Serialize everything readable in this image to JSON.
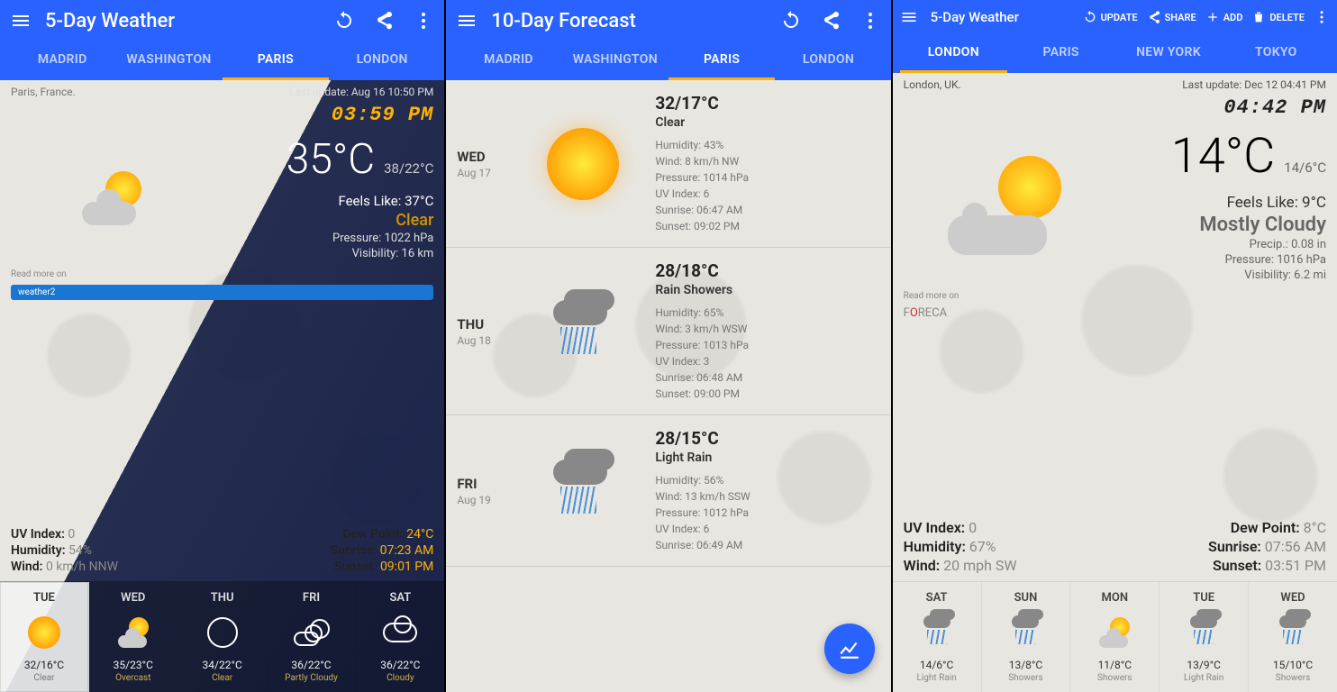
{
  "panel1": {
    "title": "5-Day Weather",
    "tabs": [
      "MADRID",
      "WASHINGTON",
      "PARIS",
      "LONDON"
    ],
    "activeTab": 2,
    "location": "Paris, France.",
    "lastUpdate": "Last update: Aug 16  10:50 PM",
    "clock": "03:59 PM",
    "temp": "35°C",
    "hilo": "38/22°C",
    "feels": "Feels Like: 37°C",
    "condition": "Clear",
    "pressure": "Pressure: 1022 hPa",
    "visibility": "Visibility: 16 km",
    "readmore": "Read more on",
    "provider": "weather2",
    "leftStats": [
      {
        "label": "UV Index:",
        "val": "0"
      },
      {
        "label": "Humidity:",
        "val": "54%"
      },
      {
        "label": "Wind:",
        "val": "0 km/h NNW"
      }
    ],
    "rightStats": [
      {
        "label": "Dew Point:",
        "val": "24°C"
      },
      {
        "label": "Sunrise:",
        "val": "07:23 AM"
      },
      {
        "label": "Sunset:",
        "val": "09:01 PM"
      }
    ],
    "forecast": [
      {
        "day": "TUE",
        "temp": "32/16°C",
        "cond": "Clear",
        "icon": "sun",
        "sel": true
      },
      {
        "day": "WED",
        "temp": "35/23°C",
        "cond": "Overcast",
        "icon": "partly",
        "sel": false
      },
      {
        "day": "THU",
        "temp": "34/22°C",
        "cond": "Clear",
        "icon": "osun",
        "sel": false
      },
      {
        "day": "FRI",
        "temp": "36/22°C",
        "cond": "Partly Cloudy",
        "icon": "opartly",
        "sel": false
      },
      {
        "day": "SAT",
        "temp": "36/22°C",
        "cond": "Cloudy",
        "icon": "ocloud",
        "sel": false
      }
    ]
  },
  "panel2": {
    "title": "10-Day Forecast",
    "tabs": [
      "MADRID",
      "WASHINGTON",
      "PARIS",
      "LONDON"
    ],
    "activeTab": 2,
    "days": [
      {
        "dn": "WED",
        "dd": "Aug 17",
        "icon": "sun",
        "temp": "32/17°C",
        "cond": "Clear",
        "lines": [
          "Humidity: 43%",
          "Wind: 8 km/h NW",
          "Pressure: 1014 hPa",
          "UV Index: 6",
          "Sunrise:  06:47 AM",
          "Sunset:  09:02 PM"
        ]
      },
      {
        "dn": "THU",
        "dd": "Aug 18",
        "icon": "rain",
        "temp": "28/18°C",
        "cond": "Rain Showers",
        "lines": [
          "Humidity: 65%",
          "Wind: 3 km/h WSW",
          "Pressure: 1013 hPa",
          "UV Index: 3",
          "Sunrise:  06:48 AM",
          "Sunset:  09:00 PM"
        ]
      },
      {
        "dn": "FRI",
        "dd": "Aug 19",
        "icon": "rain",
        "temp": "28/15°C",
        "cond": "Light Rain",
        "lines": [
          "Humidity: 56%",
          "Wind: 13 km/h SSW",
          "Pressure: 1012 hPa",
          "UV Index: 6",
          "Sunrise:  06:49 AM"
        ]
      }
    ]
  },
  "panel3": {
    "title": "5-Day Weather",
    "actions": {
      "update": "UPDATE",
      "share": "SHARE",
      "add": "ADD",
      "delete": "DELETE"
    },
    "tabs": [
      "LONDON",
      "PARIS",
      "NEW YORK",
      "TOKYO"
    ],
    "activeTab": 0,
    "location": "London, UK.",
    "lastUpdate": "Last update: Dec 12  04:41 PM",
    "clock": "04:42 PM",
    "temp": "14°C",
    "hilo": "14/6°C",
    "feels": "Feels Like: 9°C",
    "condition": "Mostly Cloudy",
    "precip": "Precip.: 0.08 in",
    "pressure": "Pressure: 1016 hPa",
    "visibility": "Visibility: 6.2 mi",
    "readmore": "Read more on",
    "provider": "FORECA",
    "leftStats": [
      {
        "label": "UV Index:",
        "val": "0"
      },
      {
        "label": "Humidity:",
        "val": "67%"
      },
      {
        "label": "Wind:",
        "val": "20 mph SW"
      }
    ],
    "rightStats": [
      {
        "label": "Dew Point:",
        "val": "8°C"
      },
      {
        "label": "Sunrise:",
        "val": "07:56 AM"
      },
      {
        "label": "Sunset:",
        "val": "03:51 PM"
      }
    ],
    "forecast": [
      {
        "day": "SAT",
        "temp": "14/6°C",
        "cond": "Light Rain",
        "icon": "rain"
      },
      {
        "day": "SUN",
        "temp": "13/8°C",
        "cond": "Showers",
        "icon": "rain"
      },
      {
        "day": "MON",
        "temp": "11/8°C",
        "cond": "Showers",
        "icon": "partly"
      },
      {
        "day": "TUE",
        "temp": "13/9°C",
        "cond": "Light Rain",
        "icon": "rain"
      },
      {
        "day": "WED",
        "temp": "15/10°C",
        "cond": "Showers",
        "icon": "rain"
      }
    ]
  }
}
